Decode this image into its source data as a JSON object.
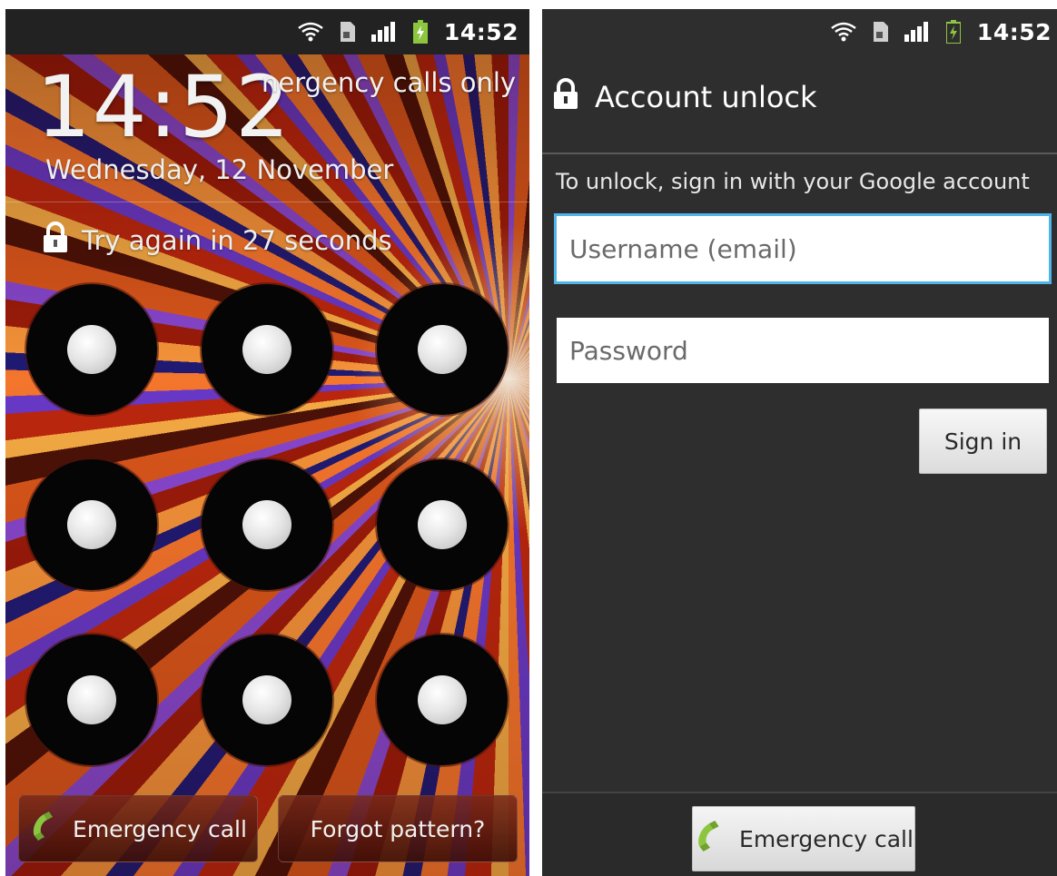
{
  "left_screen": {
    "status_bar": {
      "time": "14:52",
      "icons": [
        "wifi-icon",
        "sim-card-icon",
        "signal-icon",
        "battery-charging-icon"
      ]
    },
    "clock": "14:52",
    "carrier_text": "nergency calls only",
    "date": "Wednesday, 12 November",
    "lock_message": "Try again in 27 seconds",
    "pattern_grid_size": 9,
    "buttons": {
      "emergency_call": "Emergency call",
      "forgot_pattern": "Forgot pattern?"
    }
  },
  "right_screen": {
    "status_bar": {
      "time": "14:52",
      "icons": [
        "wifi-icon",
        "sim-card-icon",
        "signal-icon",
        "battery-charging-icon"
      ]
    },
    "title": "Account unlock",
    "instruction": "To unlock, sign in with your Google account",
    "username_placeholder": "Username (email)",
    "password_placeholder": "Password",
    "sign_in_label": "Sign in",
    "emergency_call_label": "Emergency call"
  },
  "colors": {
    "focus_ring": "#4db5e8",
    "phone_icon_green": "#8cc63f",
    "right_background": "#2e2e2e"
  }
}
